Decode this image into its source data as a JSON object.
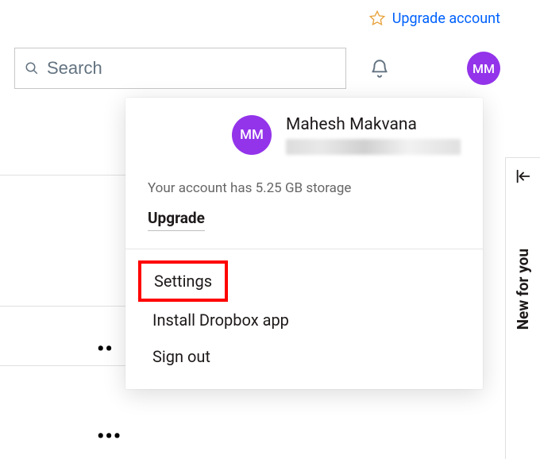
{
  "banner": {
    "link_label": "Upgrade account"
  },
  "search": {
    "placeholder": "Search"
  },
  "avatar": {
    "initials": "MM"
  },
  "menu": {
    "user_name": "Mahesh Makvana",
    "storage_text": "Your account has 5.25 GB storage",
    "upgrade_label": "Upgrade",
    "items": [
      {
        "label": "Settings"
      },
      {
        "label": "Install Dropbox app"
      },
      {
        "label": "Sign out"
      }
    ]
  },
  "side": {
    "label": "New for you"
  }
}
